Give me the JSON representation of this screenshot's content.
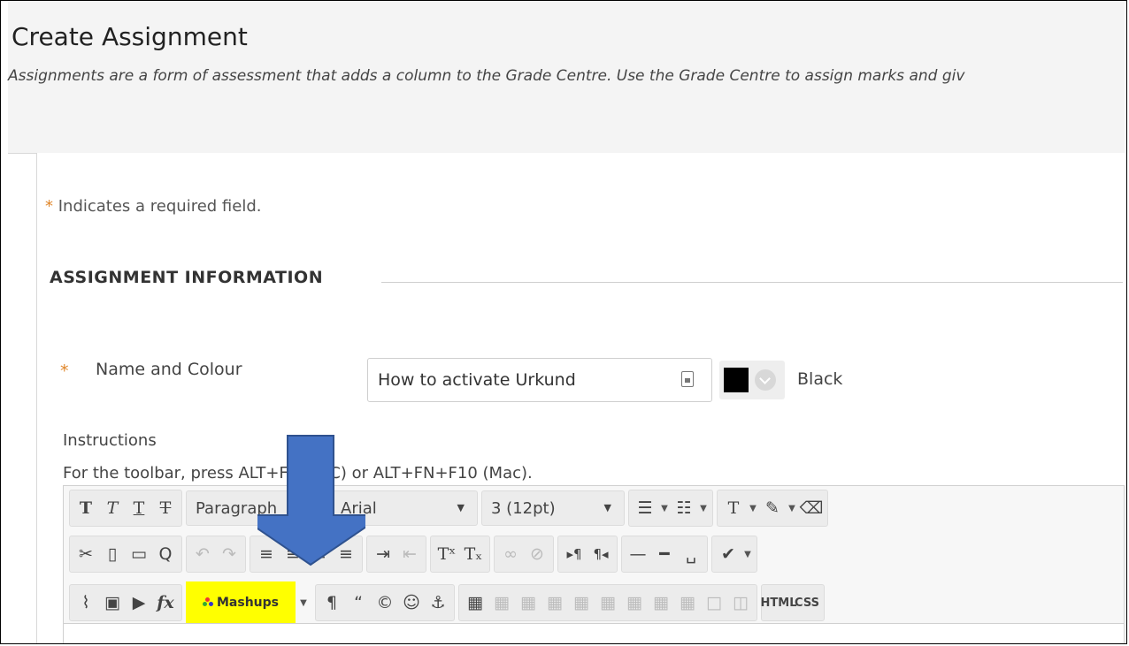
{
  "page": {
    "title": "Create Assignment",
    "description": "Assignments are a form of assessment that adds a column to the Grade Centre. Use the Grade Centre to assign marks and giv"
  },
  "form": {
    "required_marker": "*",
    "required_note": "Indicates a required field.",
    "section_title": "ASSIGNMENT INFORMATION",
    "name_label": "Name and Colour",
    "name_value": "How to activate Urkund",
    "colour_name": "Black",
    "colour_hex": "#000000",
    "instructions_label": "Instructions",
    "toolbar_hint": "For the toolbar, press ALT+F10 (PC) or ALT+FN+F10 (Mac)."
  },
  "editor": {
    "paragraph_select": "Paragraph",
    "font_select": "Arial",
    "size_select": "3 (12pt)",
    "mashups_label": "Mashups",
    "html_label": "HTML",
    "css_label": "CSS"
  },
  "colors": {
    "accent_star": "#e0862a",
    "highlight": "#ffff00",
    "arrow": "#4472c4"
  }
}
